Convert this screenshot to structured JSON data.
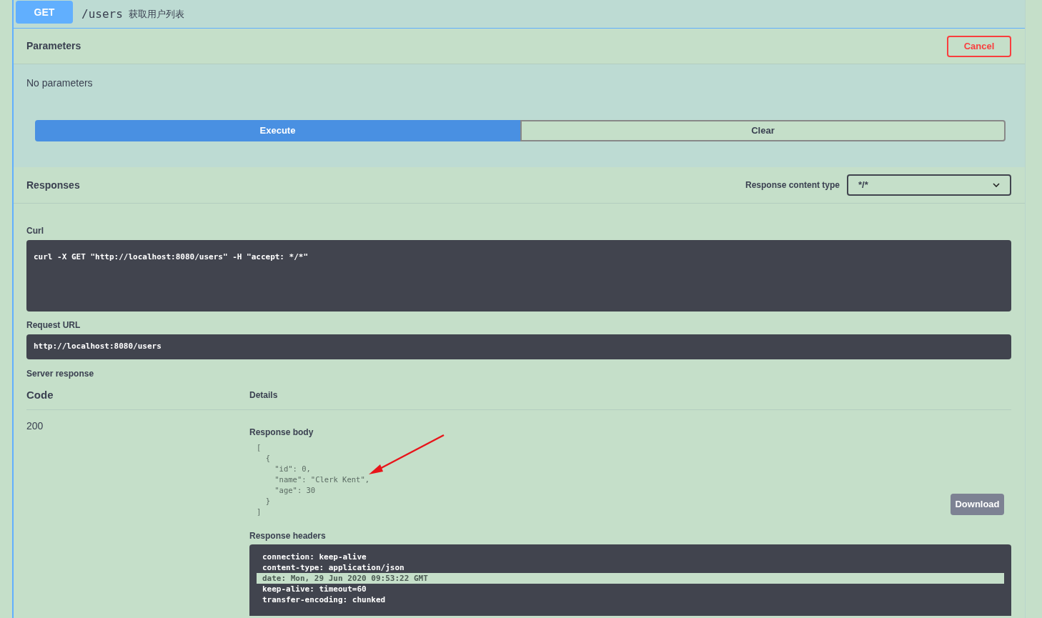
{
  "endpoint": {
    "method": "GET",
    "path": "/users",
    "summary": "获取用户列表"
  },
  "parameters": {
    "title": "Parameters",
    "cancel_button": "Cancel",
    "message": "No parameters"
  },
  "actions": [
    {
      "label": "Execute",
      "kind": "primary"
    },
    {
      "label": "Clear",
      "kind": "secondary"
    }
  ],
  "responses": {
    "title": "Responses",
    "content_type_label": "Response content type",
    "content_type_value": "*/*"
  },
  "curl": {
    "label": "Curl",
    "command": "curl -X GET \"http://localhost:8080/users\" -H \"accept: */*\""
  },
  "request_url": {
    "label": "Request URL",
    "value": "http://localhost:8080/users"
  },
  "server_response": {
    "label": "Server response",
    "columns": [
      "Code",
      "Details"
    ],
    "code": "200",
    "body_label": "Response body",
    "body_lines": [
      "[",
      "  {",
      "    \"id\": 0,",
      "    \"name\": \"Clerk Kent\",",
      "    \"age\": 30",
      "  }",
      "]"
    ],
    "download_button": "Download",
    "headers_label": "Response headers",
    "headers": [
      {
        "text": "connection: keep-alive",
        "selected": false
      },
      {
        "text": "content-type: application/json",
        "selected": false
      },
      {
        "text": "date: Mon, 29 Jun 2020 09:53:22 GMT",
        "selected": true
      },
      {
        "text": "keep-alive: timeout=60",
        "selected": false
      },
      {
        "text": "transfer-encoding: chunked",
        "selected": false
      }
    ]
  }
}
